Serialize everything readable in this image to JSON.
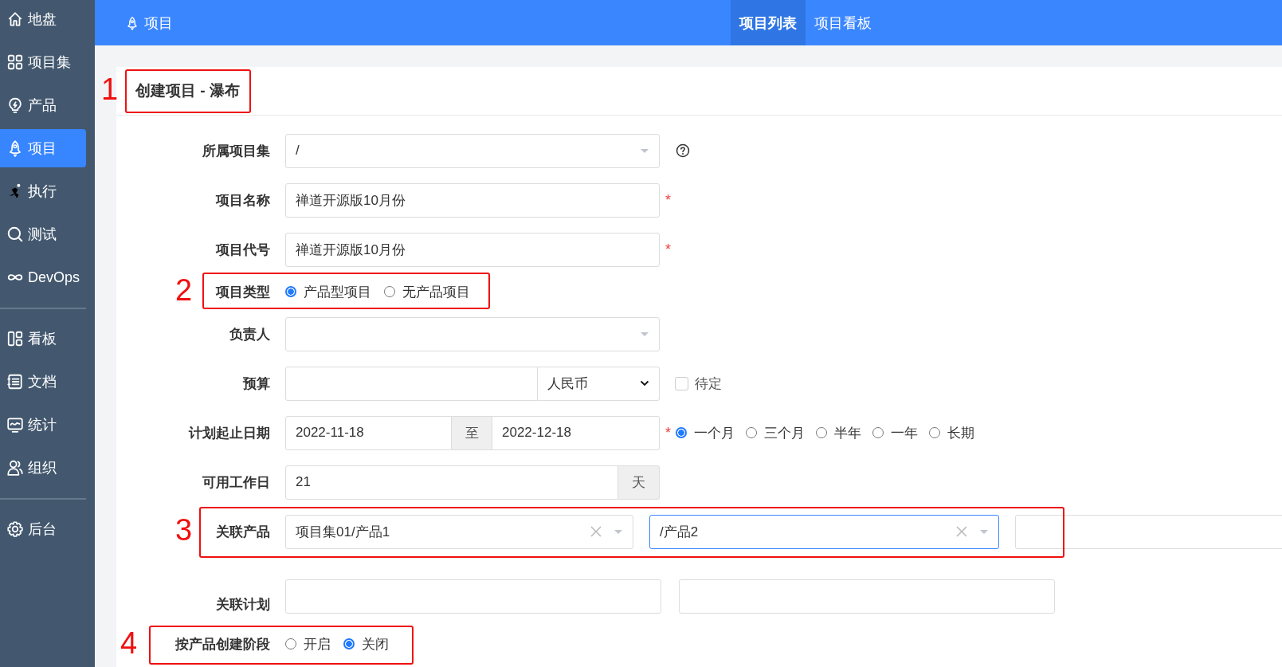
{
  "sidebar": {
    "groups": [
      {
        "items": [
          {
            "label": "地盘",
            "selected": false
          },
          {
            "label": "项目集",
            "selected": false
          },
          {
            "label": "产品",
            "selected": false
          },
          {
            "label": "项目",
            "selected": true
          },
          {
            "label": "执行",
            "selected": false
          },
          {
            "label": "测试",
            "selected": false
          },
          {
            "label": "DevOps",
            "selected": false
          }
        ]
      },
      {
        "items": [
          {
            "label": "看板",
            "selected": false
          },
          {
            "label": "文档",
            "selected": false
          },
          {
            "label": "统计",
            "selected": false
          },
          {
            "label": "组织",
            "selected": false
          }
        ]
      },
      {
        "items": [
          {
            "label": "后台",
            "selected": false
          }
        ]
      }
    ]
  },
  "header": {
    "title": "项目",
    "tabs": [
      {
        "label": "项目列表",
        "selected": true
      },
      {
        "label": "项目看板",
        "selected": false
      }
    ]
  },
  "card": {
    "title": "创建项目 - 瀑布",
    "annotation": "1"
  },
  "form": {
    "rows": [
      {
        "kind": "select",
        "label": "所属项目集",
        "value": "/",
        "help": true
      },
      {
        "kind": "text",
        "label": "项目名称",
        "value": "禅道开源版10月份",
        "required_mark": "*"
      },
      {
        "kind": "text",
        "label": "项目代号",
        "value": "禅道开源版10月份",
        "required_mark": "*"
      },
      {
        "kind": "radio",
        "label": "项目类型",
        "annotation": "2",
        "options": [
          {
            "label": "产品型项目",
            "selected": true
          },
          {
            "label": "无产品项目",
            "selected": false
          }
        ]
      },
      {
        "kind": "select",
        "label": "负责人"
      },
      {
        "kind": "budget",
        "label": "预算",
        "currency": "人民币",
        "pending": {
          "label": "待定",
          "checked": false
        }
      },
      {
        "kind": "date_range",
        "label": "计划起止日期",
        "start": "2022-11-18",
        "separator": "至",
        "end": "2022-12-18",
        "required_mark": "*",
        "presets": [
          {
            "label": "一个月",
            "selected": true
          },
          {
            "label": "三个月",
            "selected": false
          },
          {
            "label": "半年",
            "selected": false
          },
          {
            "label": "一年",
            "selected": false
          },
          {
            "label": "长期",
            "selected": false
          }
        ]
      },
      {
        "kind": "addon",
        "label": "可用工作日",
        "value": "21",
        "unit": "天"
      },
      {
        "kind": "products",
        "label": "关联产品",
        "annotation": "3",
        "selects": [
          {
            "value": "项目集01/产品1",
            "focused": false
          },
          {
            "value": "/产品2",
            "focused": true
          },
          {
            "focused": false
          }
        ]
      },
      {
        "kind": "plans",
        "label": "关联计划",
        "fields": [
          {
            "kind": "text"
          },
          {
            "kind": "text"
          }
        ]
      },
      {
        "kind": "radio",
        "label": "按产品创建阶段",
        "annotation": "4",
        "options": [
          {
            "label": "开启",
            "selected": false
          },
          {
            "label": "关闭",
            "selected": true
          }
        ]
      }
    ]
  }
}
